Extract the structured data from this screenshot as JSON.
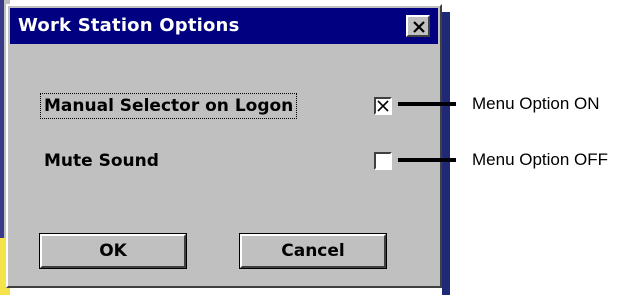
{
  "window": {
    "title": "Work Station Options",
    "close_icon": "close-icon"
  },
  "options": [
    {
      "label": "Manual Selector on Logon",
      "checked": true
    },
    {
      "label": "Mute Sound",
      "checked": false
    }
  ],
  "buttons": {
    "ok_label": "OK",
    "cancel_label": "Cancel"
  },
  "callouts": {
    "on_text": "Menu Option ON",
    "off_text": "Menu Option OFF"
  },
  "colors": {
    "titlebar": "#000080",
    "dialog_face": "#c0c0c0",
    "title_text": "#ffffff"
  }
}
